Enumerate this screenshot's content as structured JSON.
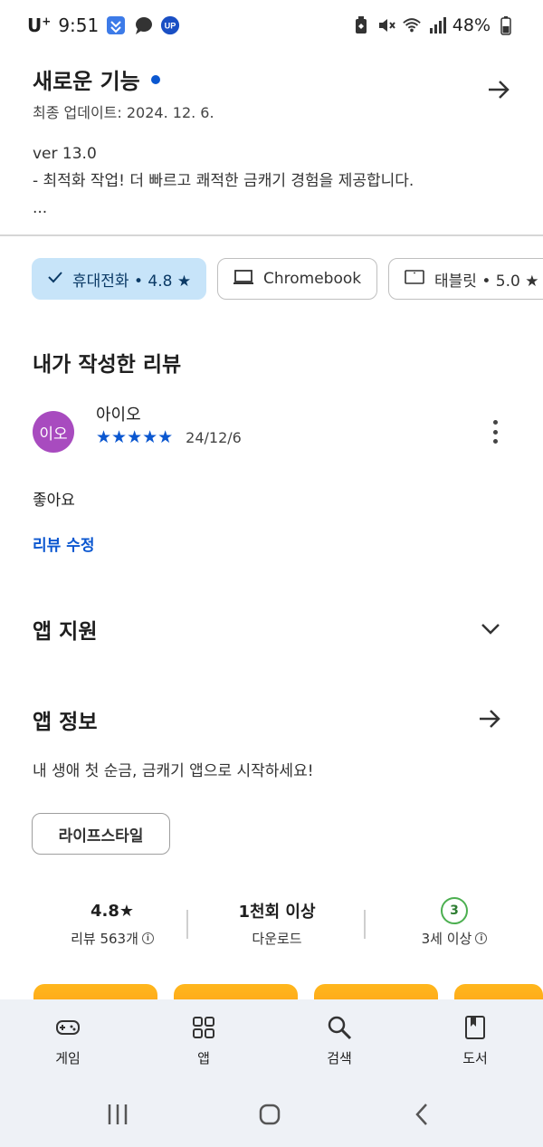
{
  "status_bar": {
    "carrier": "U",
    "carrier_sup": "+",
    "time": "9:51",
    "battery": "48%",
    "app_badge": "UP",
    "icons": [
      "app-notification-icon",
      "chat-bubble-icon",
      "up-badge-icon",
      "battery-saver-icon",
      "mute-icon",
      "wifi-icon",
      "signal-icon",
      "battery-icon"
    ]
  },
  "whats_new": {
    "title": "새로운 기능",
    "updated": "최종 업데이트: 2024. 12. 6.",
    "body_line1": "ver 13.0",
    "body_line2": "- 최적화 작업! 더 빠르고 쾌적한 금캐기 경험을 제공합니다.",
    "body_line3": "...",
    "accent_color": "#0b57d0"
  },
  "device_chips": [
    {
      "label": "휴대전화 • 4.8 ★",
      "selected": true,
      "icon": "check-icon"
    },
    {
      "label": "Chromebook",
      "selected": false,
      "icon": "laptop-icon"
    },
    {
      "label": "태블릿 • 5.0 ★",
      "selected": false,
      "icon": "tablet-icon"
    }
  ],
  "my_review": {
    "title": "내가 작성한 리뷰",
    "avatar_text": "이오",
    "avatar_color": "#a84bbf",
    "name": "아이오",
    "stars": "★★★★★",
    "rating": 5,
    "date": "24/12/6",
    "text": "좋아요",
    "edit_label": "리뷰 수정"
  },
  "app_support": {
    "title": "앱 지원"
  },
  "app_info": {
    "title": "앱 정보",
    "description": "내 생애 첫 순금, 금캐기 앱으로 시작하세요!",
    "category": "라이프스타일"
  },
  "stats": {
    "rating_value": "4.8★",
    "rating_label": "리뷰 563개",
    "downloads_value": "1천회 이상",
    "downloads_label": "다운로드",
    "age_badge": "3",
    "age_label": "3세 이상"
  },
  "bottom_nav": [
    {
      "label": "게임",
      "icon": "gamepad-icon"
    },
    {
      "label": "앱",
      "icon": "apps-grid-icon"
    },
    {
      "label": "검색",
      "icon": "search-icon"
    },
    {
      "label": "도서",
      "icon": "book-icon"
    }
  ]
}
